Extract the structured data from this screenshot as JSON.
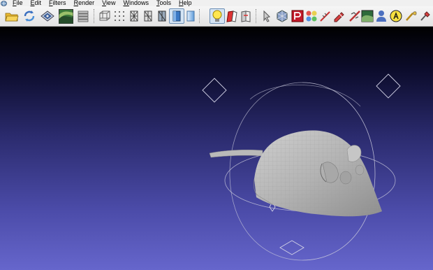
{
  "app": {
    "icon": "meshlab-app-icon"
  },
  "menu": [
    {
      "name": "menu-file",
      "mnemonic": "F",
      "rest": "ile"
    },
    {
      "name": "menu-edit",
      "mnemonic": "E",
      "rest": "dit"
    },
    {
      "name": "menu-filters",
      "mnemonic": "F",
      "rest": "ilters"
    },
    {
      "name": "menu-render",
      "mnemonic": "R",
      "rest": "ender"
    },
    {
      "name": "menu-view",
      "mnemonic": "V",
      "rest": "iew"
    },
    {
      "name": "menu-windows",
      "mnemonic": "W",
      "rest": "indows"
    },
    {
      "name": "menu-tools",
      "mnemonic": "T",
      "rest": "ools"
    },
    {
      "name": "menu-help",
      "mnemonic": "H",
      "rest": "elp"
    }
  ],
  "toolbar": {
    "icons": [
      "open-folder-icon",
      "reload-icon",
      "save-icon",
      "snapshot-icon",
      "layers-icon",
      "bounding-box-icon",
      "points-icon",
      "wireframe-icon",
      "hidden-lines-icon",
      "flat-lines-icon",
      "flat-shading-icon",
      "smooth-shading-icon",
      "lighting-icon",
      "back-face-icon",
      "double-side-icon",
      "select-faces-icon",
      "select-vertices-icon",
      "paint-icon",
      "align-icon",
      "measure-icon",
      "edit-mesh-icon",
      "texture-icon",
      "reference-icon",
      "annotation-icon",
      "manual-edit-icon"
    ]
  },
  "viewport": {
    "background_top": "#000000",
    "background_bottom": "#6666cc",
    "model": "mouse-mesh",
    "mesh_color": "#b4b4b4",
    "trackball_color": "#c8c8dc"
  }
}
